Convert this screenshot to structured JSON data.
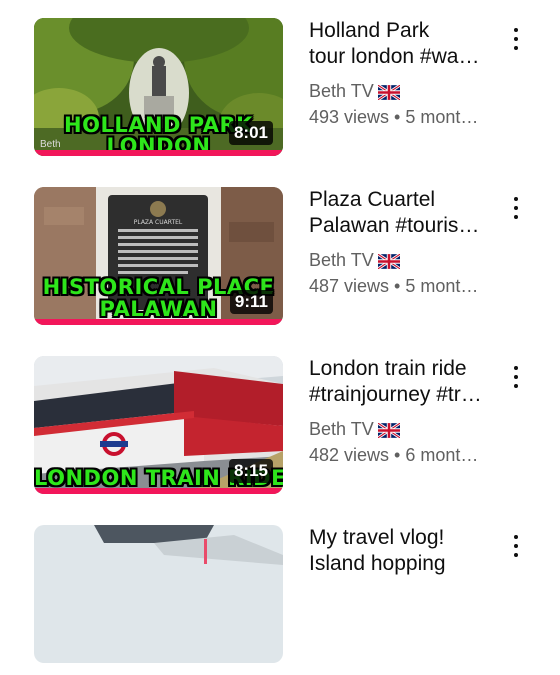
{
  "videos": [
    {
      "title_line1": "Holland Park",
      "title_line2": "tour london #wa…",
      "channel": "Beth TV",
      "meta": "493 views • 5 mont…",
      "duration": "8:01",
      "overlay_line1": "HOLLAND PARK",
      "overlay_line2": "LONDON",
      "watermark": "Beth"
    },
    {
      "title_line1": "Plaza Cuartel",
      "title_line2": "Palawan #touris…",
      "channel": "Beth TV",
      "meta": "487 views • 5 mont…",
      "duration": "9:11",
      "overlay_line1": "HISTORICAL PLACE",
      "overlay_line2": "PALAWAN",
      "plaque_heading": "PLAZA CUARTEL"
    },
    {
      "title_line1": "London train ride",
      "title_line2": "#trainjourney #tr…",
      "channel": "Beth TV",
      "meta": "482 views • 6 mont…",
      "duration": "8:15",
      "overlay_line1": "LONDON TRAIN RIDE"
    },
    {
      "title_line1": "My travel vlog!",
      "title_line2": "Island hopping"
    }
  ],
  "icons": {
    "flag": "uk-flag-icon",
    "menu": "more-vert-icon"
  },
  "colors": {
    "progress": "#f2165a",
    "overlay_text": "#2ee61b",
    "title_text": "#0f0f0f",
    "secondary_text": "#606060"
  }
}
